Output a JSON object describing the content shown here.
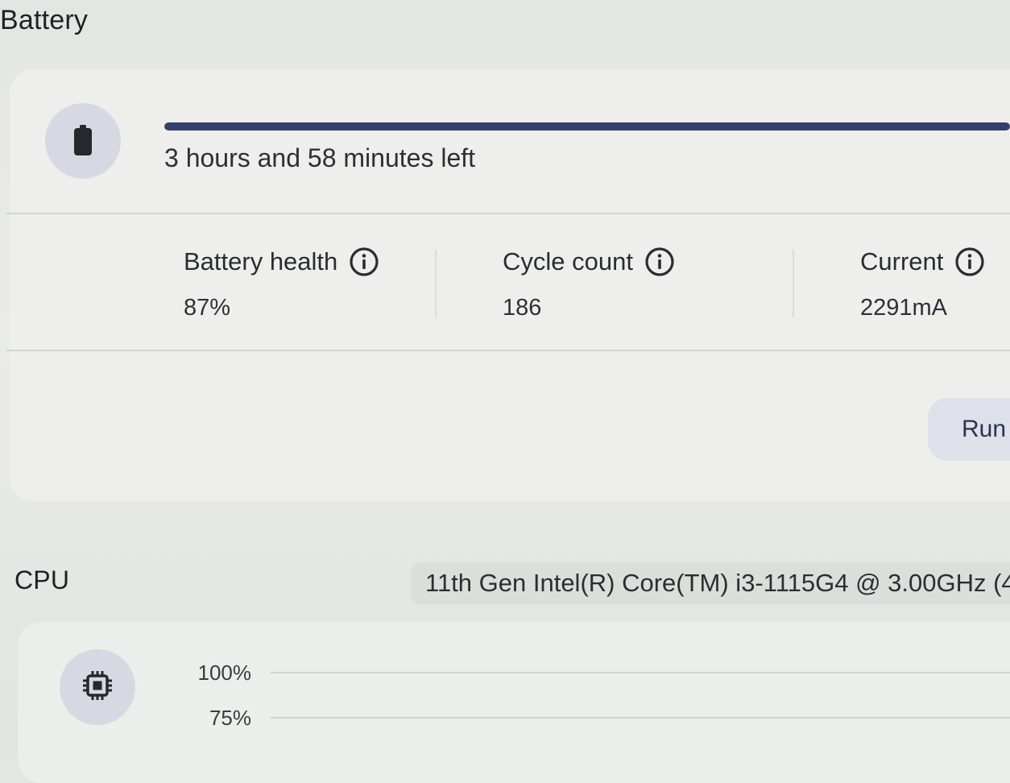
{
  "battery": {
    "title": "Battery",
    "icon": "battery-icon",
    "charge_level": 1.0,
    "time_left": "3 hours and 58 minutes left",
    "stats": [
      {
        "label": "Battery health",
        "value": "87%",
        "icon": "info-icon"
      },
      {
        "label": "Cycle count",
        "value": "186",
        "icon": "info-icon"
      },
      {
        "label": "Current",
        "value": "2291mA",
        "icon": "info-icon"
      }
    ],
    "run_button_label": "Run"
  },
  "cpu": {
    "title": "CPU",
    "icon": "cpu-chip-icon",
    "model": "11th Gen Intel(R) Core(TM) i3-1115G4 @ 3.00GHz (4",
    "chart_ticks": [
      "100%",
      "75%"
    ]
  },
  "colors": {
    "progress_fill": "#36406a",
    "progress_track": "#c5c8d2",
    "icon_circle": "#d6d9e2",
    "button_bg": "#dfe1ea"
  }
}
